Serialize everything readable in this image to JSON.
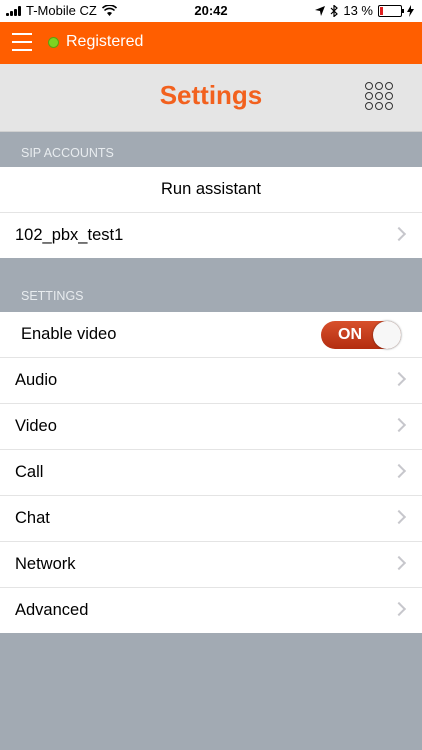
{
  "status_bar": {
    "carrier": "T-Mobile CZ",
    "time": "20:42",
    "battery": "13 %"
  },
  "top_bar": {
    "registration_status": "Registered",
    "status_color": "#7ed321",
    "bar_color": "#ff5e00"
  },
  "header": {
    "title": "Settings"
  },
  "sip_accounts": {
    "header": "SIP ACCOUNTS",
    "run_assistant": "Run assistant",
    "accounts": [
      "102_pbx_test1"
    ]
  },
  "settings": {
    "header": "SETTINGS",
    "enable_video_label": "Enable video",
    "enable_video_state": "ON",
    "items": [
      "Audio",
      "Video",
      "Call",
      "Chat",
      "Network",
      "Advanced"
    ]
  }
}
